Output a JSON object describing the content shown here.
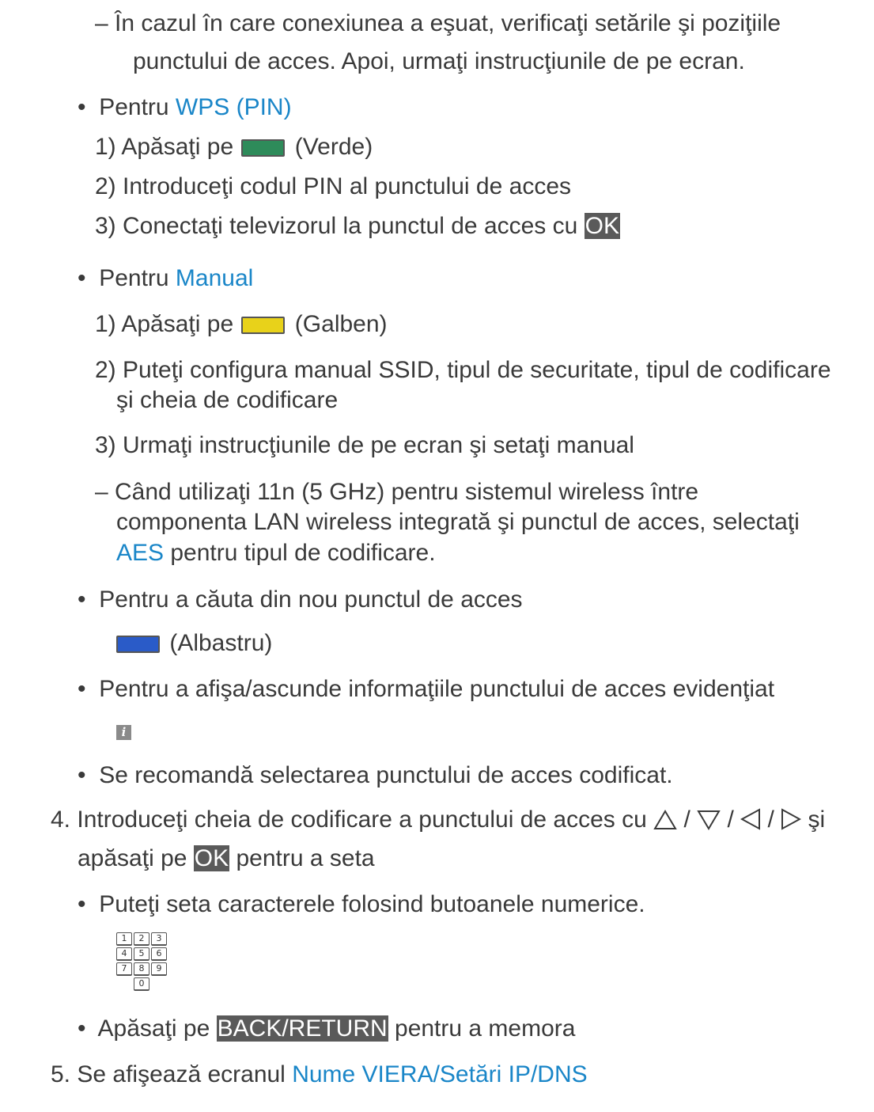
{
  "lines": {
    "l1": "–  În cazul în care conexiunea a eşuat, verificaţi setările şi poziţiile",
    "l2": "punctului de acces. Apoi, urmaţi instrucţiunile de pe ecran.",
    "wps_prefix": "Pentru ",
    "wps_link": "WPS (PIN)",
    "wps_s1_a": "1)  Apăsaţi pe ",
    "wps_s1_b": " (Verde)",
    "wps_s2": "2)  Introduceţi codul PIN al punctului de acces",
    "wps_s3_a": "3)  Conectaţi televizorul la punctul de acces cu ",
    "ok": "OK",
    "man_prefix": "Pentru ",
    "man_link": "Manual",
    "man_s1_a": "1)  Apăsaţi pe ",
    "man_s1_b": " (Galben)",
    "man_s2a": "2)  Puteţi configura manual SSID, tipul de securitate, tipul de codificare",
    "man_s2b": "şi cheia de codificare",
    "man_s3": "3)  Urmaţi instrucţiunile de pe ecran şi setaţi manual",
    "note1": "–  Când utilizaţi 11n (5 GHz) pentru sistemul wireless între",
    "note2": "componenta LAN wireless integrată şi punctul de acces, selectaţi",
    "aes": "AES",
    "note3_rest": " pentru tipul de codificare.",
    "search": "Pentru a căuta din nou punctul de acces",
    "blue_label": " (Albastru)",
    "info": "Pentru a afişa/ascunde informaţiile punctului de acces evidenţiat",
    "recommend": "Se recomandă selectarea punctului de acces codificat.",
    "step4_a": "4.  Introduceţi cheia de codificare a punctului de acces cu ",
    "step4_sep": " / ",
    "step4_end": " şi",
    "step4_b_pre": "apăsaţi pe ",
    "step4_b_post": " pentru a seta",
    "numeric": "Puteţi seta caracterele folosind butoanele numerice.",
    "back_pre": "Apăsaţi pe ",
    "back": "BACK/RETURN",
    "back_post": " pentru a memora",
    "step5_pre": "5.  Se afişează ecranul ",
    "step5_link": "Nume VIERA/Setări IP/DNS"
  },
  "bullet": "•",
  "numpad_keys": [
    "1",
    "2",
    "3",
    "4",
    "5",
    "6",
    "7",
    "8",
    "9",
    "0"
  ],
  "colors": {
    "green": "#2e8b5a",
    "yellow": "#e8d21a",
    "blue": "#2a5bc8",
    "link": "#1a86c8",
    "highlight": "#5a5a5a"
  },
  "icons": {
    "info": "i"
  }
}
